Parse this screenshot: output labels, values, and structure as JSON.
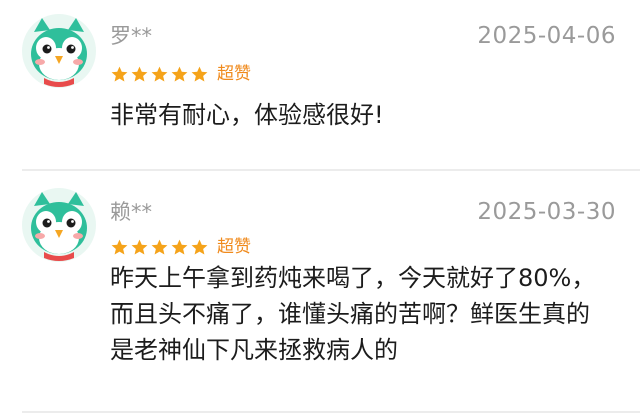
{
  "reviews": [
    {
      "username": "罗**",
      "date": "2025-04-06",
      "rating": 5,
      "rating_label": "超赞",
      "content_lines": [
        "非常有耐心，体验感很好!"
      ]
    },
    {
      "username": "赖**",
      "date": "2025-03-30",
      "rating": 5,
      "rating_label": "超赞",
      "content_lines": [
        "昨天上午拿到药炖来喝了，今天就好了80%，",
        "而且头不痛了，谁懂头痛的苦啊？鲜医生真的",
        "是老神仙下凡来拯救病人的"
      ]
    }
  ],
  "colors": {
    "star": "#f5a31a",
    "rating_label": "#f08a1c",
    "meta_text": "#9a9a9a",
    "body_text": "#1c1c1c",
    "avatar_green": "#2fbf9b",
    "avatar_beak": "#f5a623",
    "avatar_cheek": "#f7a9a9",
    "divider": "#ececec"
  },
  "icons": {
    "avatar": "green-owl-mascot-avatar",
    "star": "star-icon"
  }
}
